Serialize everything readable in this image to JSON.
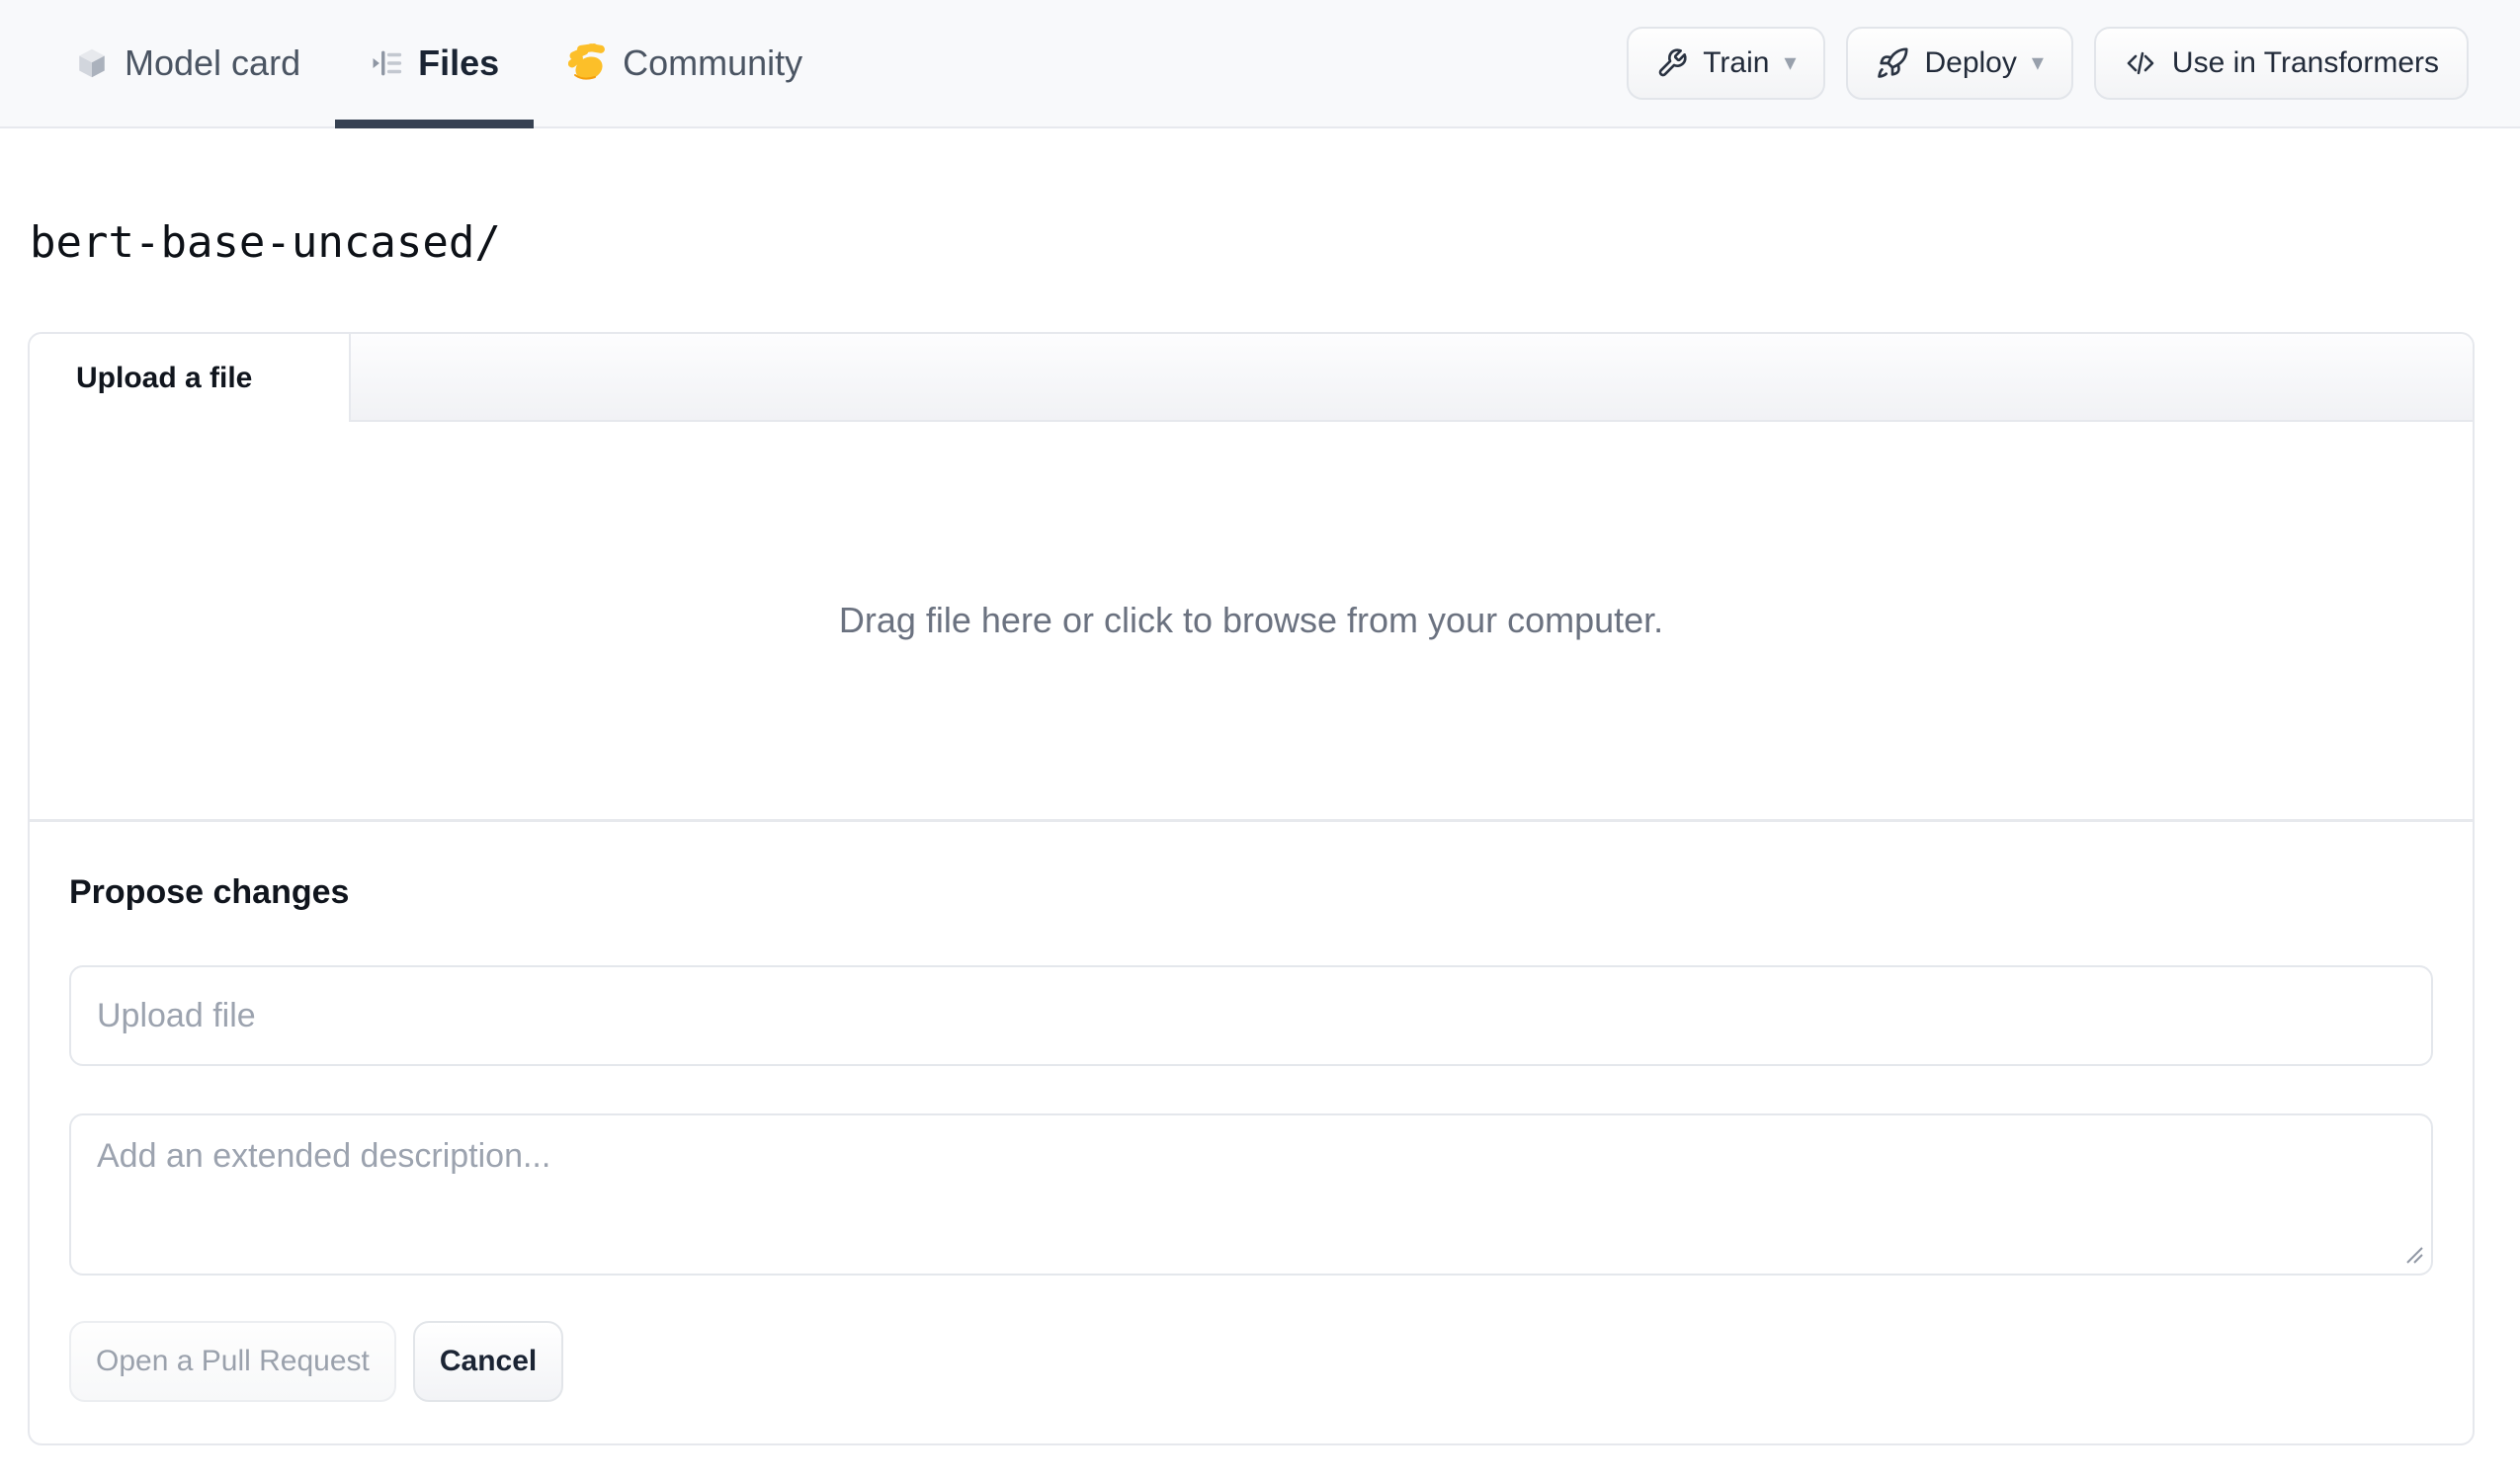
{
  "top_nav": {
    "tabs": [
      {
        "label": "Model card",
        "icon": "cube-icon",
        "active": false
      },
      {
        "label": "Files",
        "icon": "file-versions-icon",
        "active": true
      },
      {
        "label": "Community",
        "icon": "waving-hand-icon",
        "active": false
      }
    ],
    "action_buttons": [
      {
        "label": "Train",
        "icon": "wrench-icon",
        "has_caret": true
      },
      {
        "label": "Deploy",
        "icon": "rocket-icon",
        "has_caret": true
      },
      {
        "label": "Use in Transformers",
        "icon": "code-icon",
        "has_caret": false
      }
    ]
  },
  "breadcrumb": {
    "repo_path": "bert-base-uncased/"
  },
  "upload_panel": {
    "tab_label": "Upload a file",
    "dropzone_text": "Drag file here or click to browse from your computer.",
    "heading": "Propose changes",
    "file_name_placeholder": "Upload file",
    "description_placeholder": "Add an extended description...",
    "submit_label": "Open a Pull Request",
    "cancel_label": "Cancel"
  },
  "icons": {
    "caret_glyph": "▾"
  },
  "colors": {
    "header_bg": "#f8f9fb",
    "active_tab_underline": "#364152",
    "card_border": "#e6e8ed",
    "text_primary": "#1f2937",
    "text_secondary": "#4b5563",
    "muted_text": "#6b7280",
    "placeholder_text": "#9ca3af",
    "disabled_button_text": "#9aa1ac",
    "hand_icon_color": "#fbbf24"
  }
}
